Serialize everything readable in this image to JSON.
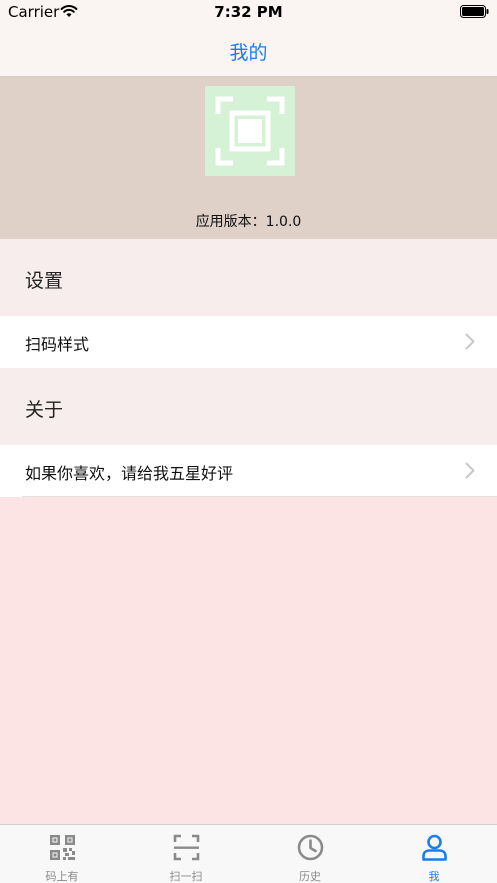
{
  "status_bar": {
    "carrier": "Carrier",
    "time": "7:32 PM"
  },
  "nav": {
    "title": "我的"
  },
  "header": {
    "version_label": "应用版本：1.0.0"
  },
  "sections": [
    {
      "title": "设置",
      "rows": [
        {
          "label": "扫码样式"
        }
      ]
    },
    {
      "title": "关于",
      "rows": [
        {
          "label": "如果你喜欢，请给我五星好评"
        }
      ]
    }
  ],
  "tabs": [
    {
      "label": "码上有",
      "icon": "qr-code-icon"
    },
    {
      "label": "扫一扫",
      "icon": "scan-frame-icon"
    },
    {
      "label": "历史",
      "icon": "clock-icon"
    },
    {
      "label": "我",
      "icon": "person-icon"
    }
  ],
  "colors": {
    "accent": "#1a7cf0",
    "header_bg": "#dfd1c8",
    "section_bg": "#f7eded",
    "page_bg": "#fde4e4",
    "tab_inactive": "#8a8a8a"
  }
}
